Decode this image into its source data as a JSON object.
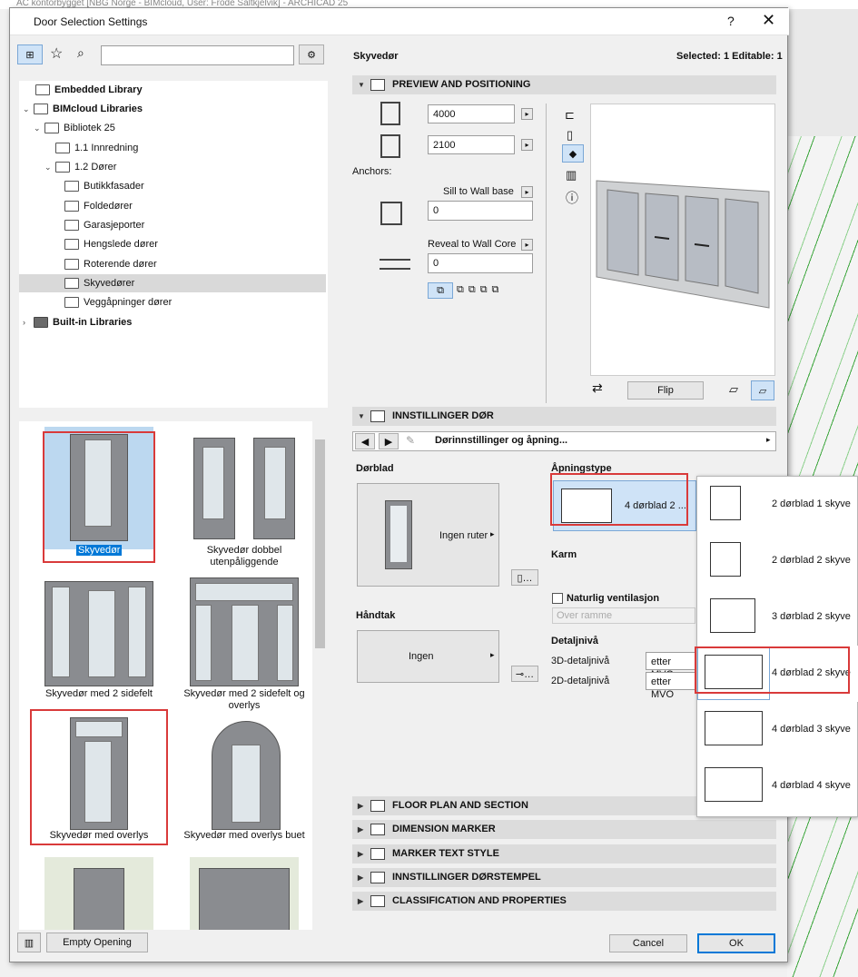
{
  "app": {
    "title": "AC kontorbygget [NBG Norge - BIMcloud, User: Frode Saltkjelvik] - ARCHICAD 25"
  },
  "dialog": {
    "title": "Door Selection Settings",
    "help": "?",
    "close": "✕"
  },
  "library": {
    "items": [
      {
        "label": "Embedded Library"
      },
      {
        "label": "BIMcloud Libraries"
      },
      {
        "label": "Bibliotek 25"
      },
      {
        "label": "1.1 Innredning"
      },
      {
        "label": "1.2 Dører"
      },
      {
        "label": "Butikkfasader"
      },
      {
        "label": "Foldedører"
      },
      {
        "label": "Garasjeporter"
      },
      {
        "label": "Hengslede dører"
      },
      {
        "label": "Roterende dører"
      },
      {
        "label": "Skyvedører"
      },
      {
        "label": "Veggåpninger dører"
      },
      {
        "label": "Built-in Libraries"
      }
    ]
  },
  "objects": [
    {
      "label": "Skyvedør"
    },
    {
      "label": "Skyvedør dobbel utenpåliggende"
    },
    {
      "label": "Skyvedør med 2 sidefelt"
    },
    {
      "label": "Skyvedør med 2 sidefelt og overlys"
    },
    {
      "label": "Skyvedør med overlys"
    },
    {
      "label": "Skyvedør med overlys buet"
    }
  ],
  "bottom": {
    "empty_opening": "Empty Opening"
  },
  "header": {
    "name": "Skyvedør",
    "selected": "Selected: 1 Editable: 1"
  },
  "preview": {
    "section": "PREVIEW AND POSITIONING",
    "width": "4000",
    "height": "2100",
    "anchors": "Anchors:",
    "sill_label": "Sill to Wall base",
    "sill_value": "0",
    "reveal_label": "Reveal to Wall Core",
    "reveal_value": "0",
    "flip": "Flip"
  },
  "settings": {
    "section": "INNSTILLINGER DØR",
    "page": "Dørinnstillinger og åpning...",
    "dorblad": "Dørblad",
    "ingen_ruter": "Ingen ruter",
    "handtak": "Håndtak",
    "ingen": "Ingen",
    "apningstype": "Åpningstype",
    "apning_value": "4 dørblad 2 ...",
    "karm": "Karm",
    "ventilasjon": "Naturlig ventilasjon",
    "over_ramme": "Over ramme",
    "detaljniva": "Detaljnivå",
    "d3": "3D-detaljnivå",
    "d2": "2D-detaljnivå",
    "d3_value": "etter MVO",
    "d2_value": "etter MVO"
  },
  "sections": [
    {
      "label": "FLOOR PLAN AND SECTION"
    },
    {
      "label": "DIMENSION MARKER"
    },
    {
      "label": "MARKER TEXT STYLE"
    },
    {
      "label": "INNSTILLINGER DØRSTEMPEL"
    },
    {
      "label": "CLASSIFICATION AND PROPERTIES"
    }
  ],
  "footer": {
    "cancel": "Cancel",
    "ok": "OK"
  },
  "popup": [
    {
      "label": "2 dørblad 1 skyve"
    },
    {
      "label": "2 dørblad 2 skyve"
    },
    {
      "label": "3 dørblad 2 skyve"
    },
    {
      "label": "4 dørblad 2 skyve"
    },
    {
      "label": "4 dørblad 3 skyve"
    },
    {
      "label": "4 dørblad 4 skyve"
    }
  ]
}
